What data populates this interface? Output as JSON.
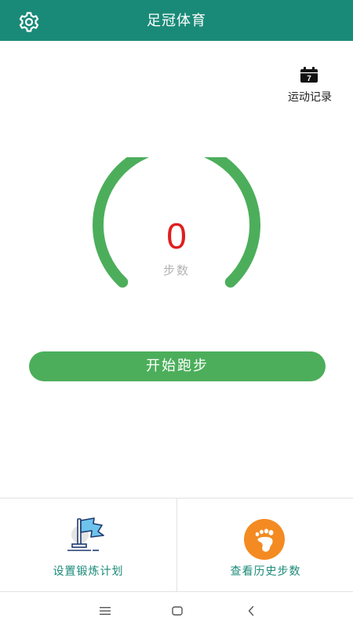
{
  "header": {
    "title": "足冠体育",
    "settings_icon": "gear-icon",
    "background": "#1a8a78"
  },
  "record": {
    "icon": "calendar-icon",
    "icon_number": "7",
    "label": "运动记录"
  },
  "step_meter": {
    "count": "0",
    "label": "步数",
    "arc_color": "#4cae5b",
    "count_color": "#e01e1e"
  },
  "start_button": {
    "label": "开始跑步",
    "color": "#4cae5b"
  },
  "actions": [
    {
      "label": "设置锻炼计划",
      "icon": "flag-icon"
    },
    {
      "label": "查看历史步数",
      "icon": "footprint-icon"
    }
  ],
  "nav": {
    "menu_icon": "menu-icon",
    "home_icon": "home-icon",
    "back_icon": "back-icon"
  }
}
